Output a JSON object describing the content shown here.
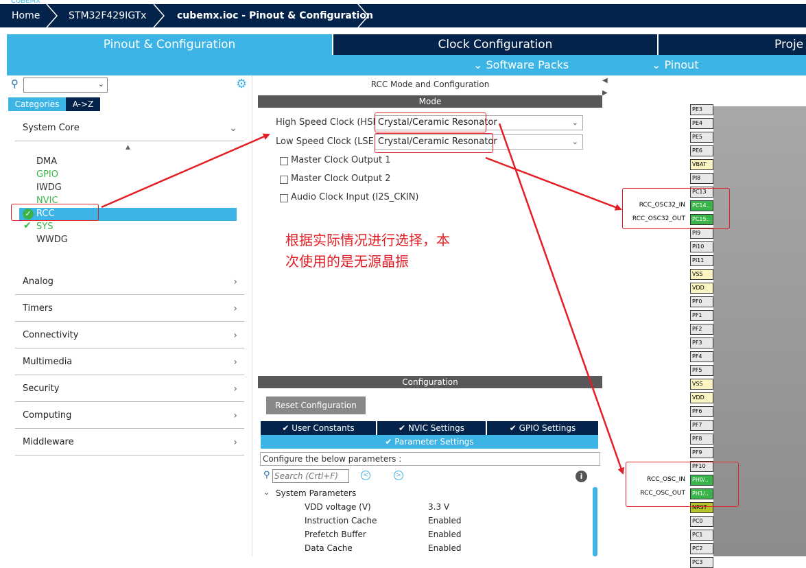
{
  "breadcrumb": {
    "items": [
      "Home",
      "STM32F429IGTx",
      "cubemx.ioc - Pinout & Configuration"
    ]
  },
  "tabs": [
    {
      "label": "Pinout & Configuration",
      "active": true
    },
    {
      "label": "Clock Configuration",
      "active": false
    },
    {
      "label": "Proje",
      "active": false
    }
  ],
  "subtabs": {
    "software_packs": "Software Packs",
    "pinout": "Pinout"
  },
  "left": {
    "search_value": "",
    "view_tabs": [
      "Categories",
      "A->Z"
    ],
    "system_core": {
      "label": "System Core",
      "items": [
        {
          "label": "DMA",
          "color": "#333333",
          "check": false
        },
        {
          "label": "GPIO",
          "color": "#3ab44a",
          "check": false
        },
        {
          "label": "IWDG",
          "color": "#333333",
          "check": false
        },
        {
          "label": "NVIC",
          "color": "#3ab44a",
          "check": false
        },
        {
          "label": "RCC",
          "color": "#ffffff",
          "check": true,
          "selected": true
        },
        {
          "label": "SYS",
          "color": "#3ab44a",
          "check": true
        },
        {
          "label": "WWDG",
          "color": "#333333",
          "check": false
        }
      ]
    },
    "categories": [
      "Analog",
      "Timers",
      "Connectivity",
      "Multimedia",
      "Security",
      "Computing",
      "Middleware"
    ]
  },
  "mode": {
    "title": "RCC Mode and Configuration",
    "section": "Mode",
    "hse_label": "High Speed Clock (HSE)",
    "hse_value": "Crystal/Ceramic Resonator",
    "lse_label": "Low Speed Clock (LSE)",
    "lse_value": "Crystal/Ceramic Resonator",
    "checkboxes": [
      "Master Clock Output 1",
      "Master Clock Output 2",
      "Audio Clock Input (I2S_CKIN)"
    ]
  },
  "annotation": {
    "line1": "根据实际情况进行选择，本",
    "line2": "次使用的是无源晶振"
  },
  "config": {
    "section": "Configuration",
    "reset": "Reset Configuration",
    "tabs": [
      "User Constants",
      "NVIC Settings",
      "GPIO Settings"
    ],
    "active_tab": "Parameter Settings",
    "hint": "Configure the below parameters :",
    "search_placeholder": "Search (Crtl+F)",
    "group": "System Parameters",
    "params": [
      {
        "name": "VDD voltage (V)",
        "value": "3.3 V"
      },
      {
        "name": "Instruction Cache",
        "value": "Enabled"
      },
      {
        "name": "Prefetch Buffer",
        "value": "Enabled"
      },
      {
        "name": "Data Cache",
        "value": "Enabled"
      }
    ]
  },
  "pins": [
    {
      "label": "PE3",
      "style": "gray"
    },
    {
      "label": "PE4",
      "style": "gray"
    },
    {
      "label": "PE5",
      "style": "gray"
    },
    {
      "label": "PE6",
      "style": "gray"
    },
    {
      "label": "VBAT",
      "style": "yellow"
    },
    {
      "label": "PI8",
      "style": "gray"
    },
    {
      "label": "PC13",
      "style": "gray"
    },
    {
      "label": "PC14..",
      "style": "green",
      "signal": "RCC_OSC32_IN"
    },
    {
      "label": "PC15..",
      "style": "green",
      "signal": "RCC_OSC32_OUT"
    },
    {
      "label": "PI9",
      "style": "gray"
    },
    {
      "label": "PI10",
      "style": "gray"
    },
    {
      "label": "PI11",
      "style": "gray"
    },
    {
      "label": "VSS",
      "style": "yellow"
    },
    {
      "label": "VDD",
      "style": "yellow"
    },
    {
      "label": "PF0",
      "style": "gray"
    },
    {
      "label": "PF1",
      "style": "gray"
    },
    {
      "label": "PF2",
      "style": "gray"
    },
    {
      "label": "PF3",
      "style": "gray"
    },
    {
      "label": "PF4",
      "style": "gray"
    },
    {
      "label": "PF5",
      "style": "gray"
    },
    {
      "label": "VSS",
      "style": "yellow"
    },
    {
      "label": "VDD",
      "style": "yellow"
    },
    {
      "label": "PF6",
      "style": "gray"
    },
    {
      "label": "PF7",
      "style": "gray"
    },
    {
      "label": "PF8",
      "style": "gray"
    },
    {
      "label": "PF9",
      "style": "gray"
    },
    {
      "label": "PF10",
      "style": "gray"
    },
    {
      "label": "PH0/..",
      "style": "green",
      "signal": "RCC_OSC_IN"
    },
    {
      "label": "PH1/..",
      "style": "green",
      "signal": "RCC_OSC_OUT"
    },
    {
      "label": "NRST",
      "style": "olive"
    },
    {
      "label": "PC0",
      "style": "gray"
    },
    {
      "label": "PC1",
      "style": "gray"
    },
    {
      "label": "PC2",
      "style": "gray"
    },
    {
      "label": "PC3",
      "style": "gray"
    }
  ],
  "colors": {
    "navy": "#03234b",
    "accent": "#3cb4e6",
    "green": "#3ab44a",
    "red": "#e31e24"
  }
}
